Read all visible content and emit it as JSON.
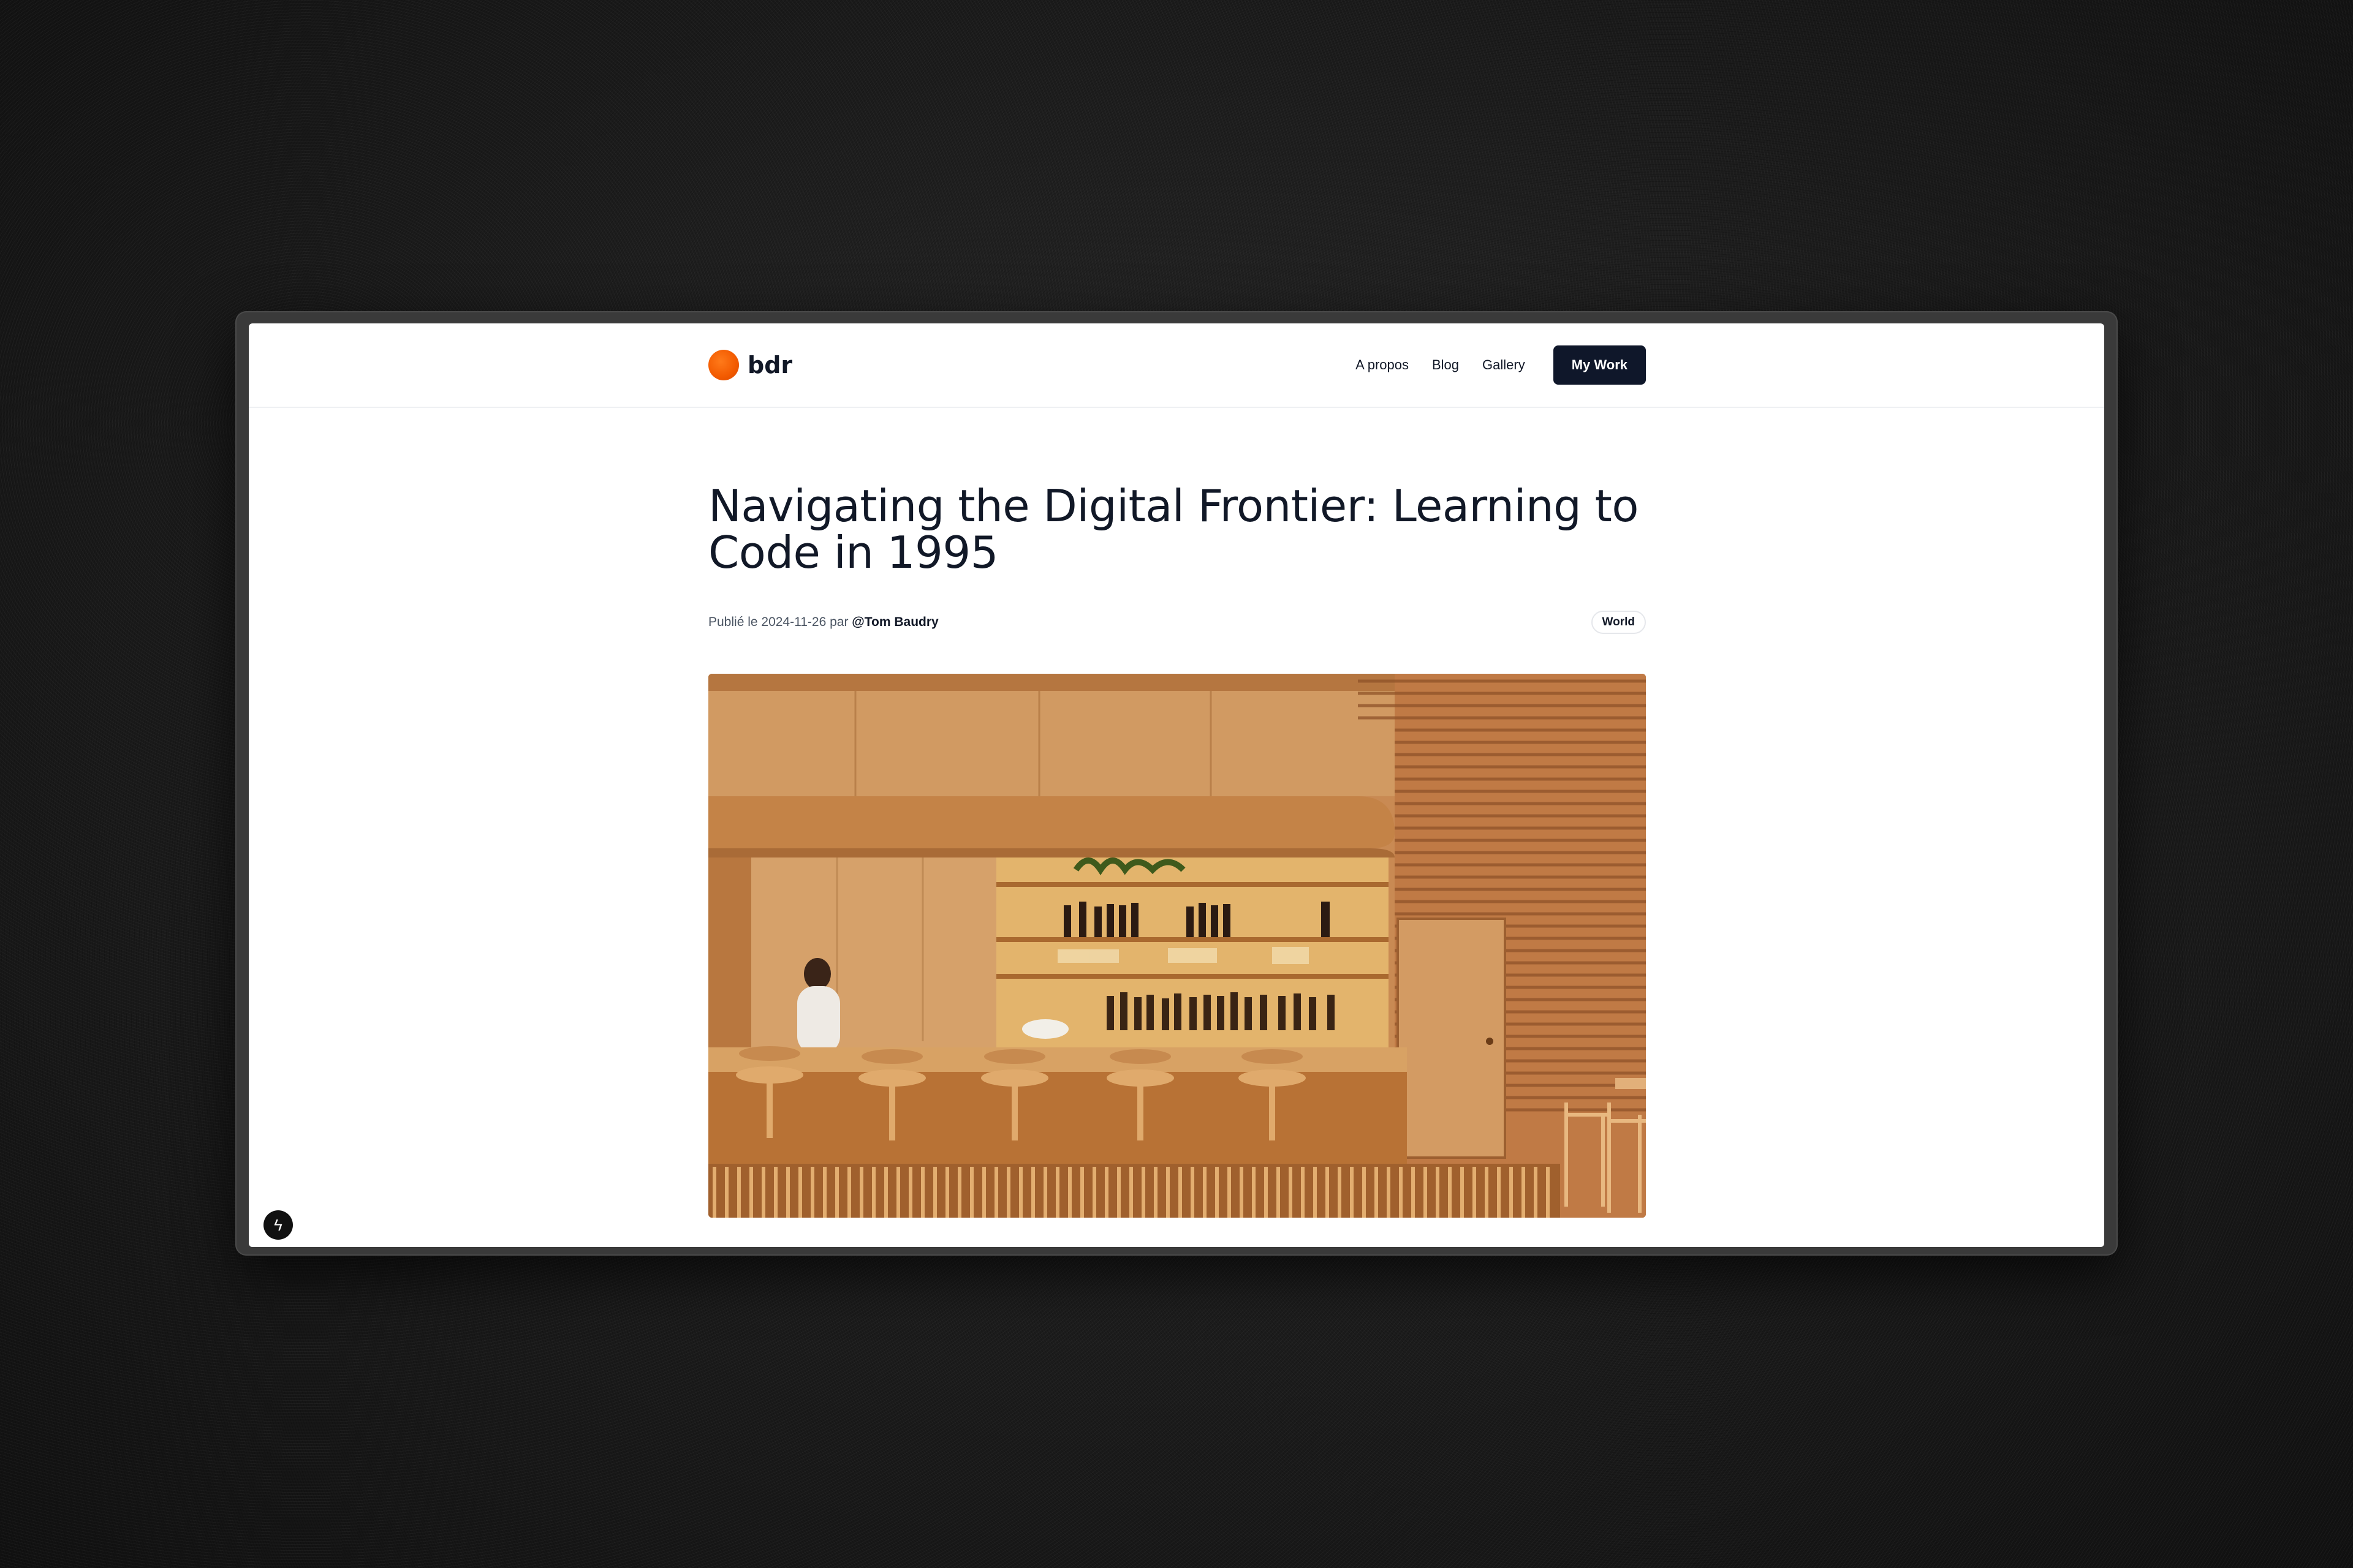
{
  "brand": {
    "name": "bdr"
  },
  "nav": {
    "links": [
      "A propos",
      "Blog",
      "Gallery"
    ],
    "cta": "My Work"
  },
  "article": {
    "title": "Navigating the Digital Frontier: Learning to Code in 1995",
    "meta_prefix": "Publié le 2024-11-26 par ",
    "author": "@Tom Baudry",
    "tag": "World"
  },
  "hero_image": {
    "subject": "warm wooden bar interior with stools and shelves of bottles"
  },
  "icons": {
    "devtools": "lightning-icon"
  },
  "colors": {
    "accent": "#f25a00",
    "button": "#0f172a",
    "text": "#111827"
  }
}
